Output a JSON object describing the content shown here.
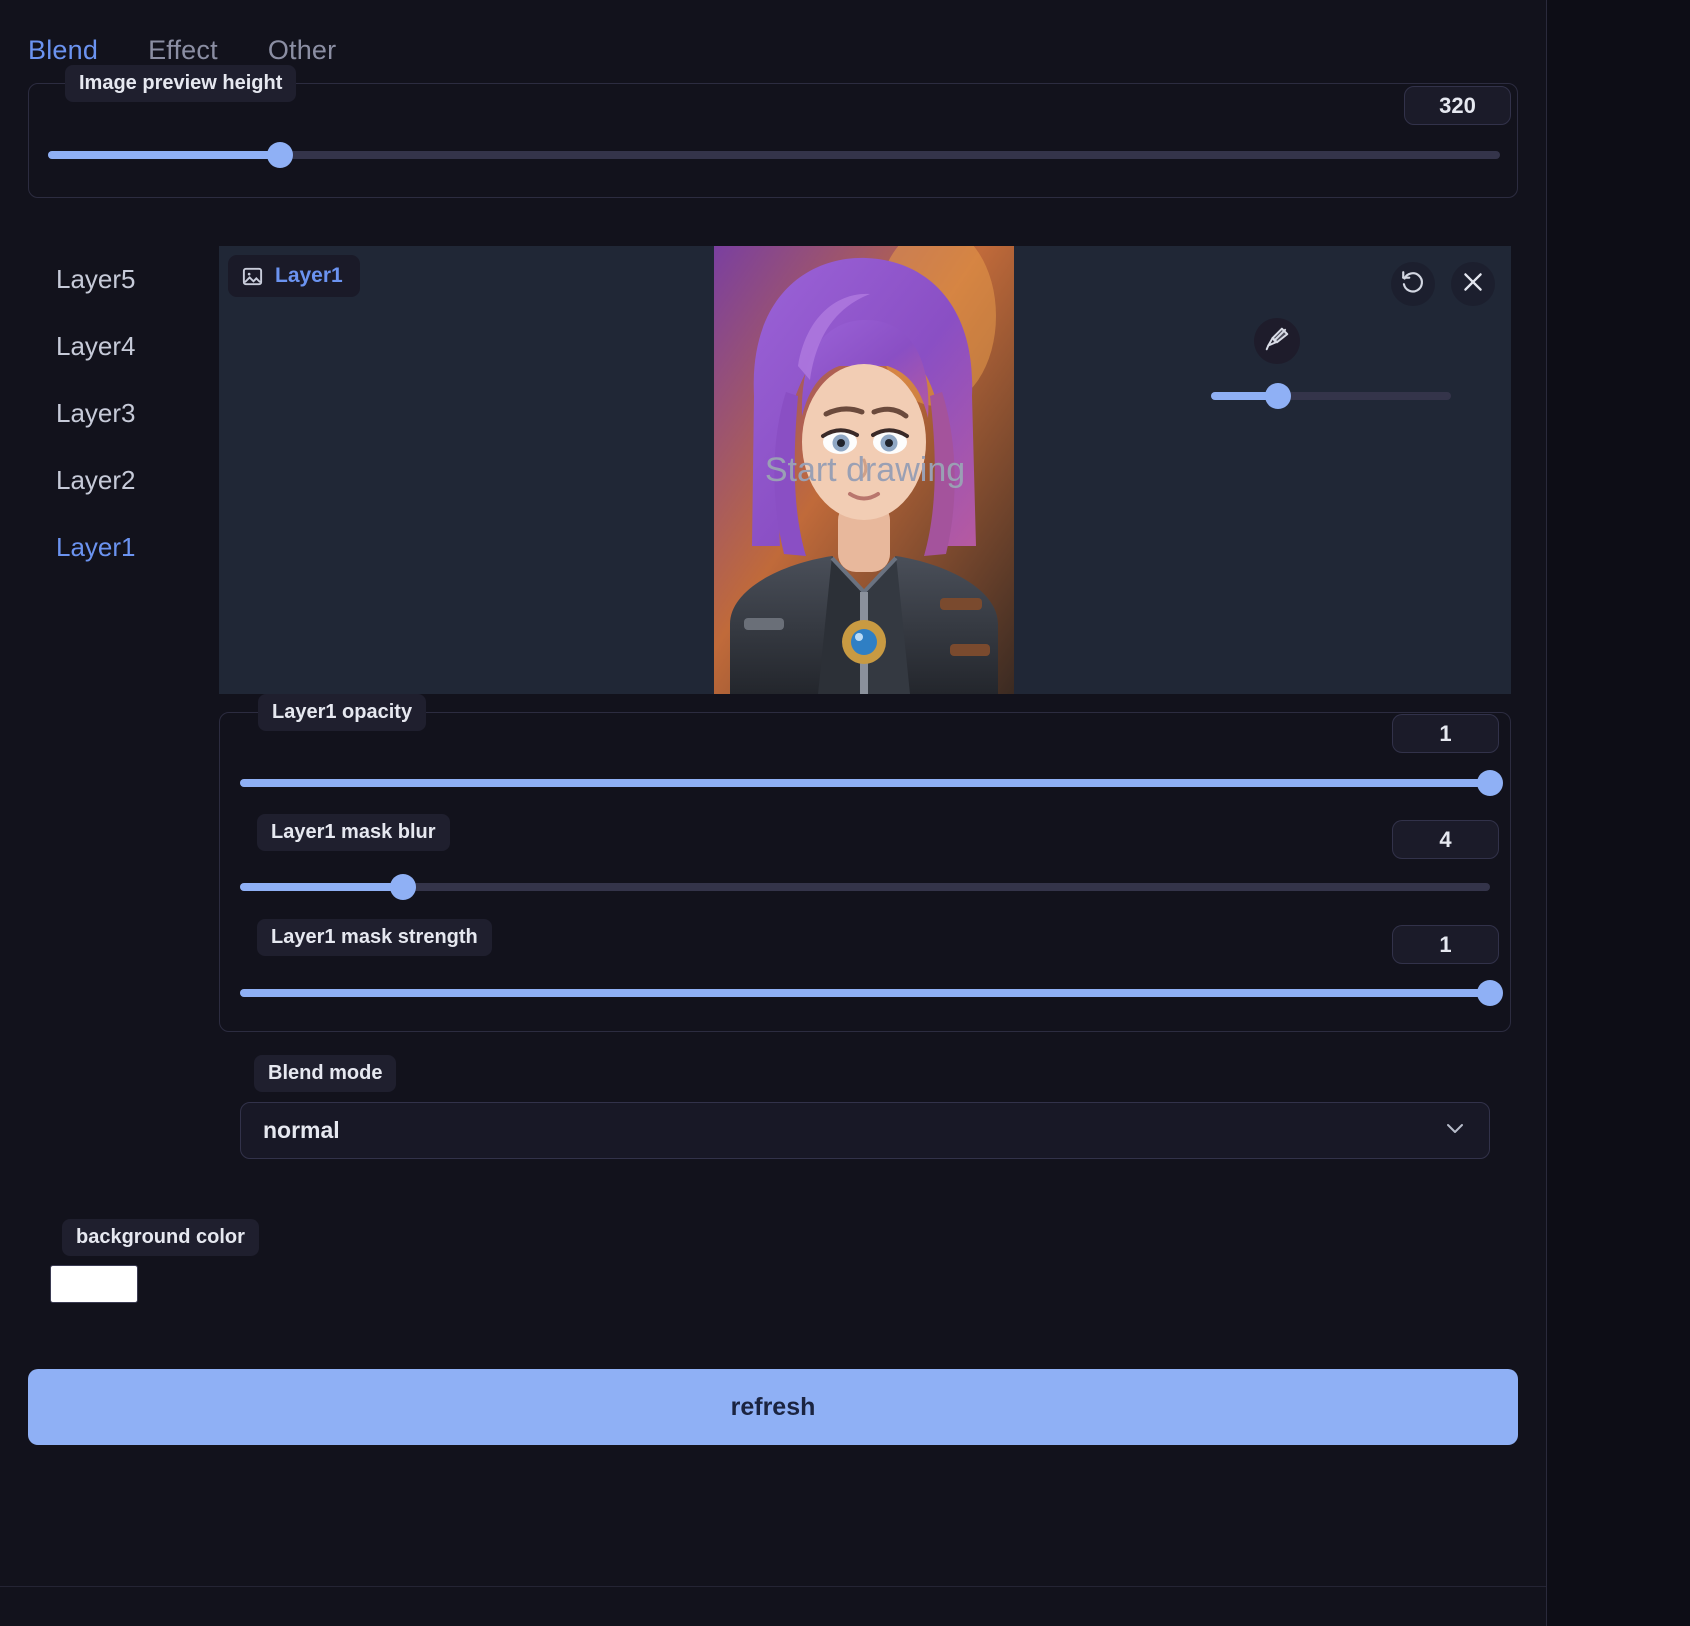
{
  "tabs": [
    {
      "label": "Blend",
      "active": true
    },
    {
      "label": "Effect",
      "active": false
    },
    {
      "label": "Other",
      "active": false
    }
  ],
  "preview_height": {
    "legend": "Image preview height",
    "value": "320",
    "percent": 16
  },
  "layers": [
    {
      "label": "Layer5"
    },
    {
      "label": "Layer4"
    },
    {
      "label": "Layer3"
    },
    {
      "label": "Layer2"
    },
    {
      "label": "Layer1"
    }
  ],
  "canvas": {
    "badge_label": "Layer1",
    "badge_icon": "image-icon",
    "placeholder": "Start drawing",
    "undo_icon": "undo-icon",
    "close_icon": "close-icon",
    "brush_icon": "brush-icon",
    "brush_size_percent": 28
  },
  "controls": [
    {
      "legend": "Layer1 opacity",
      "value": "1",
      "percent": 100
    },
    {
      "legend": "Layer1 mask blur",
      "value": "4",
      "percent": 13
    },
    {
      "legend": "Layer1 mask strength",
      "value": "1",
      "percent": 100
    }
  ],
  "blend_mode": {
    "legend": "Blend mode",
    "value": "normal",
    "chevron_icon": "chevron-down-icon"
  },
  "background_color": {
    "legend": "background color",
    "value": "#ffffff"
  },
  "refresh": {
    "label": "refresh"
  },
  "colors": {
    "accent": "#6b93f0",
    "slider_fill": "#8fb0f5",
    "page_bg": "#12121c",
    "canvas_bg": "#202736"
  }
}
